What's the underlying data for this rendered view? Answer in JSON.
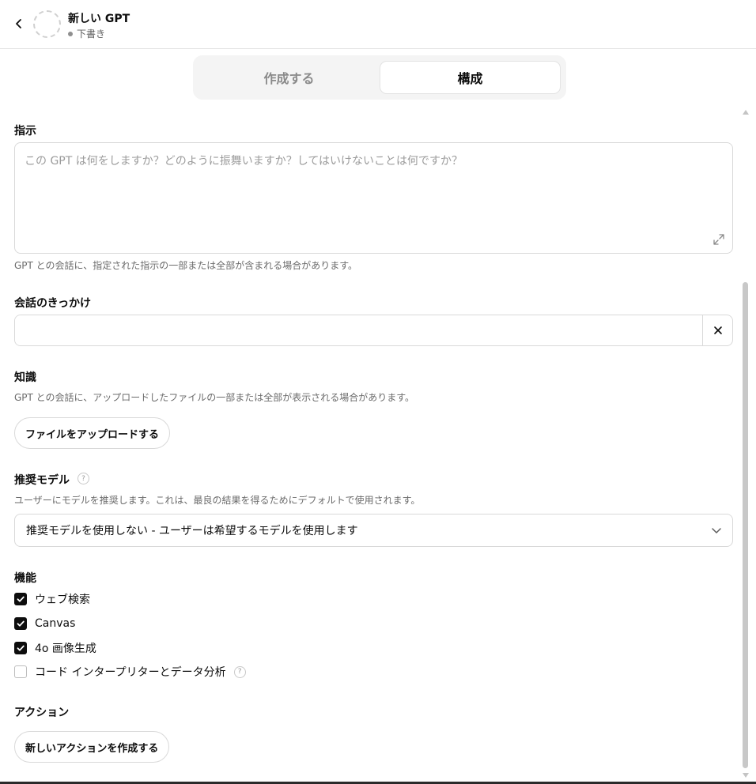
{
  "header": {
    "gpt_name": "新しい GPT",
    "status": "下書き",
    "back_icon": "chevron-left-icon"
  },
  "tabs": [
    {
      "label": "作成する",
      "active": false
    },
    {
      "label": "構成",
      "active": true
    }
  ],
  "instructions": {
    "label": "指示",
    "placeholder": "この GPT は何をしますか？どのように振舞いますか？してはいけないことは何ですか？",
    "value": "",
    "helper": "GPT との会話に、指定された指示の一部または全部が含まれる場合があります。"
  },
  "conversation_starters": {
    "label": "会話のきっかけ",
    "value": "",
    "clear_icon": "close-icon"
  },
  "knowledge": {
    "label": "知識",
    "helper": "GPT との会話に、アップロードしたファイルの一部または全部が表示される場合があります。",
    "upload_button": "ファイルをアップロードする"
  },
  "recommended_model": {
    "label": "推奨モデル",
    "help": "?",
    "helper": "ユーザーにモデルを推奨します。これは、最良の結果を得るためにデフォルトで使用されます。",
    "selected": "推奨モデルを使用しない - ユーザーは希望するモデルを使用します"
  },
  "capabilities": {
    "label": "機能",
    "items": [
      {
        "label": "ウェブ検索",
        "checked": true
      },
      {
        "label": "Canvas",
        "checked": true
      },
      {
        "label": "4o 画像生成",
        "checked": true
      },
      {
        "label": "コード インタープリターとデータ分析",
        "checked": false,
        "help": "?"
      }
    ]
  },
  "actions": {
    "label": "アクション",
    "create_button": "新しいアクションを作成する"
  },
  "colors": {
    "text": "#0d0d0d",
    "muted": "#6b6b6b",
    "border": "#d9d9d9",
    "tab_bg": "#f4f4f4",
    "checkbox_checked": "#0d0d0d"
  }
}
